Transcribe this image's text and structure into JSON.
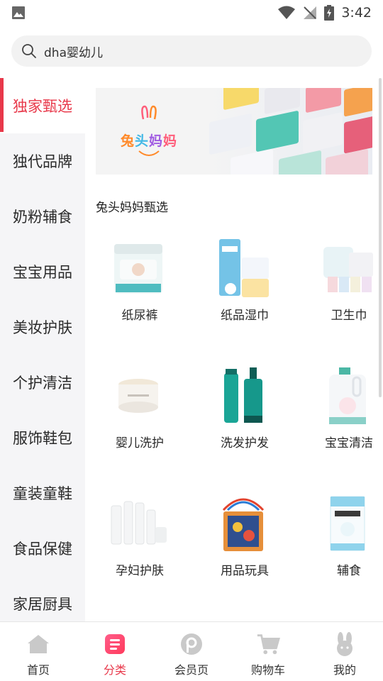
{
  "status_bar": {
    "time": "3:42",
    "icons": [
      "gallery-icon",
      "wifi-icon",
      "no-signal-icon",
      "battery-icon"
    ]
  },
  "search": {
    "value": "dha婴幼儿",
    "icon": "search-icon"
  },
  "sidebar": {
    "active_index": 0,
    "active_color": "#e8384a",
    "items": [
      {
        "label": "独家甄选"
      },
      {
        "label": "独代品牌"
      },
      {
        "label": "奶粉辅食"
      },
      {
        "label": "宝宝用品"
      },
      {
        "label": "美妆护肤"
      },
      {
        "label": "个护清洁"
      },
      {
        "label": "服饰鞋包"
      },
      {
        "label": "童装童鞋"
      },
      {
        "label": "食品保健"
      },
      {
        "label": "家居厨具"
      }
    ]
  },
  "banner": {
    "brand_text": "兔头妈妈"
  },
  "section": {
    "title": "兔头妈妈甄选"
  },
  "products": [
    {
      "label": "纸尿裤",
      "icon": "diaper-pack-icon"
    },
    {
      "label": "纸品湿巾",
      "icon": "tissue-pack-icon"
    },
    {
      "label": "卫生巾",
      "icon": "sanitary-pad-icon"
    },
    {
      "label": "婴儿洗护",
      "icon": "cream-jar-icon"
    },
    {
      "label": "洗发护发",
      "icon": "shampoo-bottle-icon"
    },
    {
      "label": "宝宝清洁",
      "icon": "detergent-bottle-icon"
    },
    {
      "label": "孕妇护肤",
      "icon": "skincare-set-icon"
    },
    {
      "label": "用品玩具",
      "icon": "toy-cube-icon"
    },
    {
      "label": "辅食",
      "icon": "food-box-icon"
    }
  ],
  "bottom_nav": {
    "active_index": 1,
    "items": [
      {
        "label": "首页",
        "icon": "home-icon"
      },
      {
        "label": "分类",
        "icon": "category-icon"
      },
      {
        "label": "会员页",
        "icon": "member-icon"
      },
      {
        "label": "购物车",
        "icon": "cart-icon"
      },
      {
        "label": "我的",
        "icon": "rabbit-profile-icon"
      }
    ]
  }
}
